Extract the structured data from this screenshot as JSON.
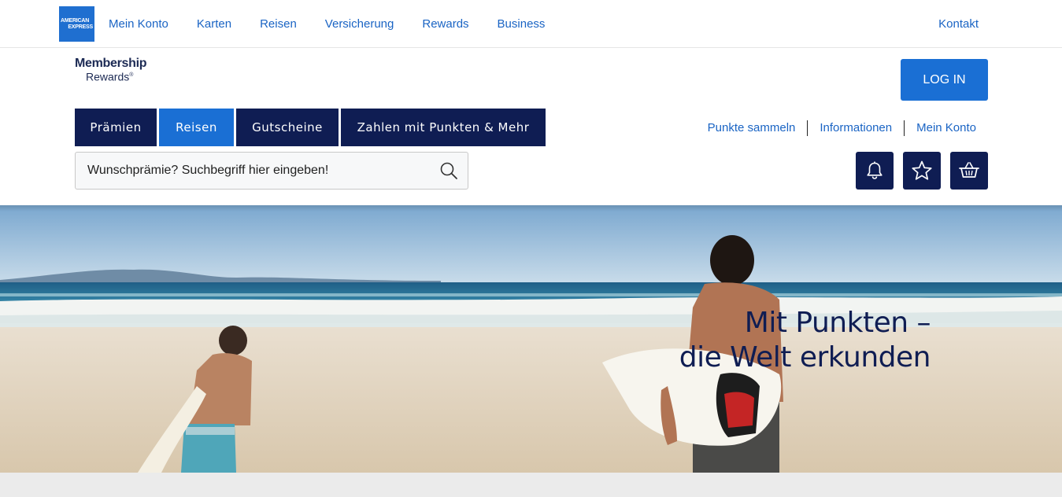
{
  "brand": {
    "logo_line1": "AMERICAN",
    "logo_line2": "EXPRESS",
    "accent": "#1a6fd4",
    "navy": "#0f1d53"
  },
  "topnav": {
    "items": [
      "Mein Konto",
      "Karten",
      "Reisen",
      "Versicherung",
      "Rewards",
      "Business"
    ],
    "contact": "Kontakt"
  },
  "membership_logo": {
    "line1": "Membership",
    "line2": "Rewards"
  },
  "login_label": "LOG IN",
  "tabs": [
    {
      "label": "Prämien",
      "active": false
    },
    {
      "label": "Reisen",
      "active": true
    },
    {
      "label": "Gutscheine",
      "active": false
    },
    {
      "label": "Zahlen mit Punkten & Mehr",
      "active": false
    }
  ],
  "right_links": [
    "Punkte sammeln",
    "Informationen",
    "Mein Konto"
  ],
  "search": {
    "placeholder": "Wunschprämie? Suchbegriff hier eingeben!"
  },
  "icons": [
    "bell-icon",
    "star-icon",
    "basket-icon",
    "search-icon"
  ],
  "hero": {
    "line1": "Mit Punkten –",
    "line2": "die Welt erkunden"
  }
}
